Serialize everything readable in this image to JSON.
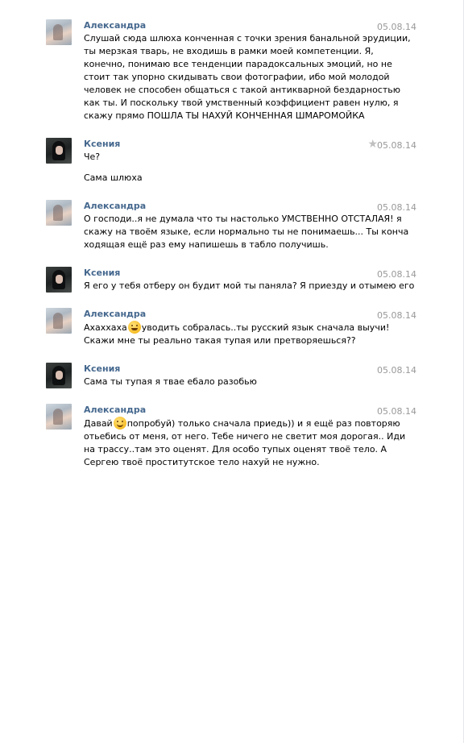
{
  "messages": [
    {
      "author": "Александра",
      "date": "05.08.14",
      "avatar": "alexandra",
      "text": "Слушай сюда шлюха конченная с точки зрения банальной эрудиции, ты мерзкая тварь, не входишь в рамки моей компетенции. Я, конечно, понимаю все тенденции парадоксальных эмоций, но не стоит так упорно скидывать свои фотографии, ибо мой молодой человек не способен общаться с такой антикварной бездарностью как ты. И поскольку твой умственный коэффициент равен нулю, я скажу прямо ПОШЛА ТЫ НАХУЙ КОНЧЕННАЯ ШМАРОМОЙКА"
    },
    {
      "author": "Ксения",
      "date": "05.08.14",
      "avatar": "ksenia",
      "text": "Че?",
      "text2": "Сама шлюха",
      "star_icon": "star-icon"
    },
    {
      "author": "Александра",
      "date": "05.08.14",
      "avatar": "alexandra",
      "text": "О господи..я не думала что ты настолько УМСТВЕННО ОТСТАЛАЯ! я скажу на твоём языке, если нормально ты не понимаешь... Ты конча ходящая ещё раз ему напишешь в табло получишь."
    },
    {
      "author": "Ксения",
      "date": "05.08.14",
      "avatar": "ksenia",
      "text": "Я его у тебя отберу он будит мой ты паняла? Я приезду и отымею его"
    },
    {
      "author": "Александра",
      "date": "05.08.14",
      "avatar": "alexandra",
      "text_before": "Ахаххаха",
      "emoji": "grin-emoji",
      "text_after": "уводить собралась..ты русский язык сначала выучи! Скажи мне ты реально такая тупая или претворяешься??"
    },
    {
      "author": "Ксения",
      "date": "05.08.14",
      "avatar": "ksenia",
      "text": "Сама ты тупая я твае ебало разобью"
    },
    {
      "author": "Александра",
      "date": "05.08.14",
      "avatar": "alexandra",
      "text_before": "Давай",
      "emoji": "blush-emoji",
      "text_after": "попробуй) только сначала приедь)) и я ещё раз повторяю отьебись от меня, от него. Тебе ничего не светит моя дорогая.. Иди на трассу..там это оценят. Для особо тупых оценят твоё тело. А Сергею твоё проститутское тело нахуй не нужно."
    }
  ],
  "colors": {
    "author": "#45688e",
    "date": "#999999",
    "text": "#000000",
    "background": "#ffffff"
  }
}
